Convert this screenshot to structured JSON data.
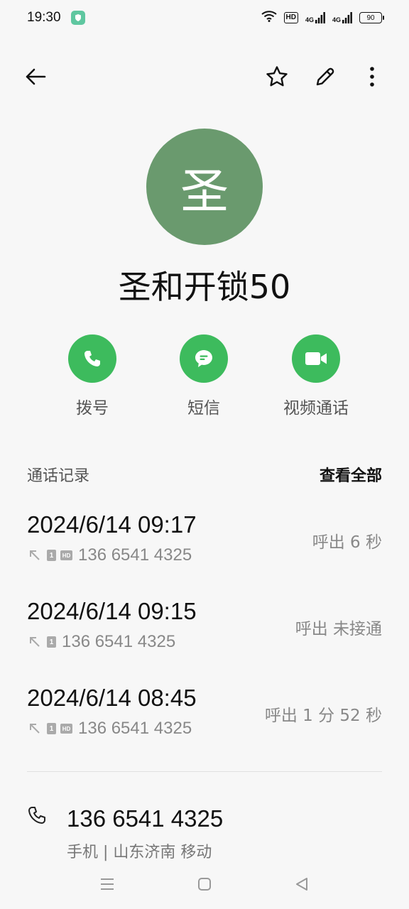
{
  "status_bar": {
    "time": "19:30",
    "hd_label": "HD",
    "network_1": "4G",
    "network_2": "4G",
    "battery": "90"
  },
  "toolbar": {
    "back_icon": "arrow-left-icon",
    "favorite_icon": "star-outline-icon",
    "edit_icon": "pencil-icon",
    "more_icon": "more-vertical-icon"
  },
  "contact": {
    "avatar_initial": "圣",
    "avatar_color": "#6a9a6e",
    "name": "圣和开锁50"
  },
  "actions": [
    {
      "label": "拨号",
      "icon": "phone-icon"
    },
    {
      "label": "短信",
      "icon": "message-icon"
    },
    {
      "label": "视频通话",
      "icon": "video-icon"
    }
  ],
  "accent_color": "#3dbb5d",
  "call_history": {
    "title": "通话记录",
    "view_all": "查看全部",
    "entries": [
      {
        "date": "2024/6/14 09:17",
        "number": "136 6541 4325",
        "status": "呼出  6 秒",
        "hd": true
      },
      {
        "date": "2024/6/14 09:15",
        "number": "136 6541 4325",
        "status": "呼出 未接通",
        "hd": false
      },
      {
        "date": "2024/6/14 08:45",
        "number": "136 6541 4325",
        "status": "呼出  1 分 52 秒",
        "hd": true
      }
    ]
  },
  "phone": {
    "number": "136 6541 4325",
    "subtitle": "手机  |  山东济南 移动"
  },
  "nav": {
    "menu_icon": "menu-icon",
    "home_icon": "home-square-icon",
    "back_icon": "back-triangle-icon"
  }
}
